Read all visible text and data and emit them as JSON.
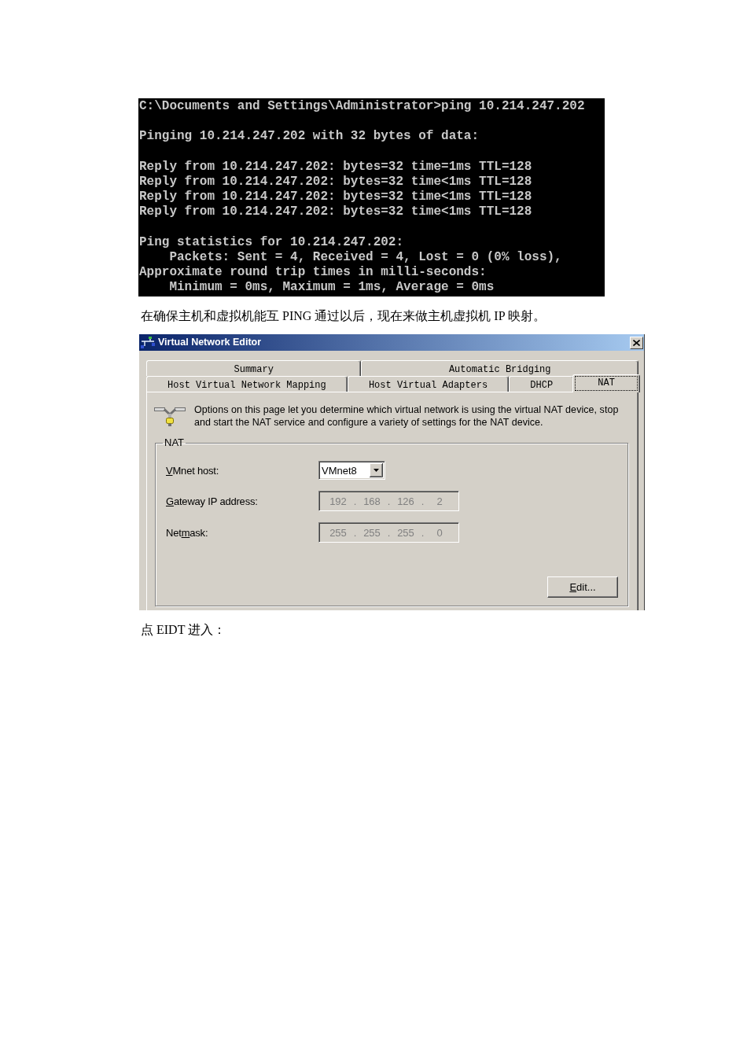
{
  "console": {
    "blocks": [
      {
        "lines": [
          "C:\\Documents and Settings\\Administrator>ping 10.214.247.202"
        ]
      },
      {
        "lines": [
          "Pinging 10.214.247.202 with 32 bytes of data:"
        ]
      },
      {
        "lines": [
          "Reply from 10.214.247.202: bytes=32 time=1ms TTL=128",
          "Reply from 10.214.247.202: bytes=32 time<1ms TTL=128",
          "Reply from 10.214.247.202: bytes=32 time<1ms TTL=128",
          "Reply from 10.214.247.202: bytes=32 time<1ms TTL=128"
        ]
      },
      {
        "lines": [
          "Ping statistics for 10.214.247.202:",
          "    Packets: Sent = 4, Received = 4, Lost = 0 (0% loss),",
          "Approximate round trip times in milli-seconds:",
          "    Minimum = 0ms, Maximum = 1ms, Average = 0ms"
        ]
      }
    ]
  },
  "caption": "在确保主机和虚拟机能互 PING 通过以后，现在来做主机虚拟机 IP 映射。",
  "dialog": {
    "title": "Virtual Network Editor",
    "tab_rows": [
      {
        "tabs": [
          {
            "label": "Summary",
            "selected": false
          },
          {
            "label": "Automatic Bridging",
            "selected": false
          }
        ]
      },
      {
        "tabs": [
          {
            "label": "Host Virtual Network Mapping",
            "selected": false
          },
          {
            "label": "Host Virtual Adapters",
            "selected": false
          },
          {
            "label": "DHCP",
            "selected": false
          },
          {
            "label": "NAT",
            "selected": true
          }
        ]
      }
    ],
    "description": "Options on this page let you determine which virtual network is using the virtual NAT device, stop and start the NAT service and configure a variety of settings for the NAT device.",
    "group": {
      "title": "NAT",
      "fields": [
        {
          "kind": "dropdown",
          "label": {
            "key": "V",
            "after": "Mnet host:"
          },
          "value": "VMnet8",
          "disabled": false
        },
        {
          "kind": "ip",
          "label": {
            "key": "G",
            "after": "ateway IP address:"
          },
          "segments": [
            "192",
            ".",
            "168",
            ".",
            "126",
            ".",
            "2"
          ],
          "disabled": true
        },
        {
          "kind": "ip",
          "label": {
            "before": "Net",
            "key": "m",
            "after": "ask:"
          },
          "segments": [
            "255",
            ".",
            "255",
            ".",
            "255",
            ".",
            "0"
          ],
          "disabled": true
        }
      ],
      "edit_button": {
        "label": {
          "key": "E",
          "after": "dit..."
        }
      }
    }
  },
  "instruction": "点 EIDT 进入："
}
